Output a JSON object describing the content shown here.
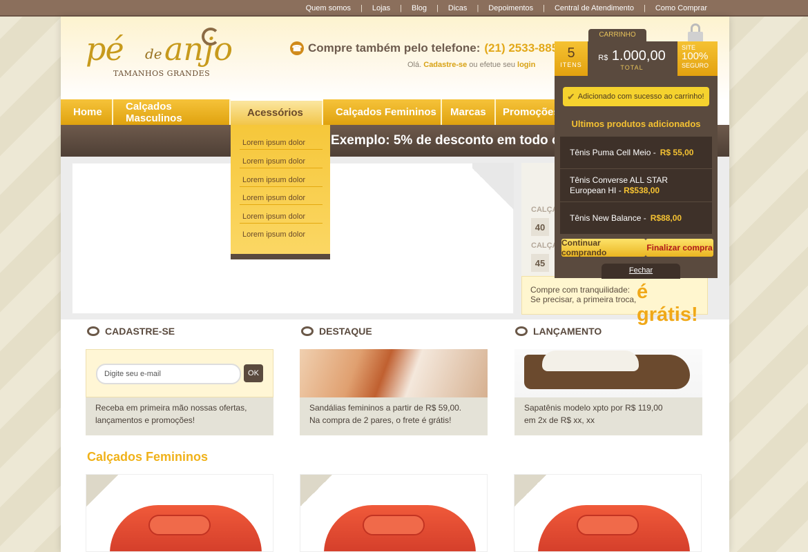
{
  "top_links": [
    "Quem somos",
    "Lojas",
    "Blog",
    "Dicas",
    "Depoimentos",
    "Central de Atendimento",
    "Como Comprar"
  ],
  "logo": {
    "pe": "pé",
    "de": "de",
    "anjo": "anjo",
    "tagline": "TAMANHOS GRANDES"
  },
  "phone": {
    "label": "Compre também pelo telefone:",
    "number": "(21) 2533-8855"
  },
  "login_line": {
    "prefix": "Olá.",
    "register": "Cadastre-se",
    "middle": "ou efetue seu",
    "login": "login"
  },
  "nav": [
    "Home",
    "Calçados Masculinos",
    "Acessórios",
    "Calçados Femininos",
    "Marcas",
    "Promoções"
  ],
  "promo_text": "nal: Exemplo: 5% de desconto em todo o",
  "dropdown": [
    "Lorem ipsum dolor",
    "Lorem ipsum dolor",
    "Lorem ipsum dolor",
    "Lorem ipsum dolor",
    "Lorem ipsum dolor",
    "Lorem ipsum dolor"
  ],
  "sizes": {
    "label1": "CALÇA",
    "num1": "40",
    "label2": "CALÇA",
    "num2": "45"
  },
  "gratis": {
    "line1": "Compre com tranquilidade:",
    "line2": "Se precisar, a primeira troca,",
    "big": "é grátis!"
  },
  "cart": {
    "tab": "CARRINHO",
    "items_count": "5",
    "items_label": "ITENS",
    "currency": "R$",
    "total": "1.000,00",
    "total_label": "TOTAL",
    "secure_top": "SITE",
    "secure_pct": "100%",
    "secure_bottom": "SEGURO",
    "success": "Adicionado com sucesso ao carrinho!",
    "recent_title": "Ultimos produtos adicionados",
    "products": [
      {
        "name": "Tênis Puma Cell Meio",
        "price": "R$ 55,00"
      },
      {
        "name": "Tênis Converse ALL STAR European HI",
        "price": "R$538,00"
      },
      {
        "name": "Tênis New Balance",
        "price": "R$88,00"
      }
    ],
    "continue": "Continuar comprando",
    "checkout": "Finalizar compra",
    "close": "Fechar"
  },
  "sections": {
    "signup": {
      "title": "CADASTRE-SE",
      "placeholder": "Digite seu e-mail",
      "ok": "OK",
      "desc1": "Receba em primeira mão nossas ofertas,",
      "desc2": "lançamentos e promoções!"
    },
    "featured": {
      "title": "DESTAQUE",
      "desc1": "Sandálias femininos  a partir de R$ 59,00.",
      "desc2": "Na compra de 2 pares, o frete é grátis!"
    },
    "launch": {
      "title": "LANÇAMENTO",
      "desc1": "Sapatênis modelo xpto por R$ 119,00",
      "desc2": "em 2x de R$ xx, xx"
    }
  },
  "womens_title": "Calçados Femininos"
}
